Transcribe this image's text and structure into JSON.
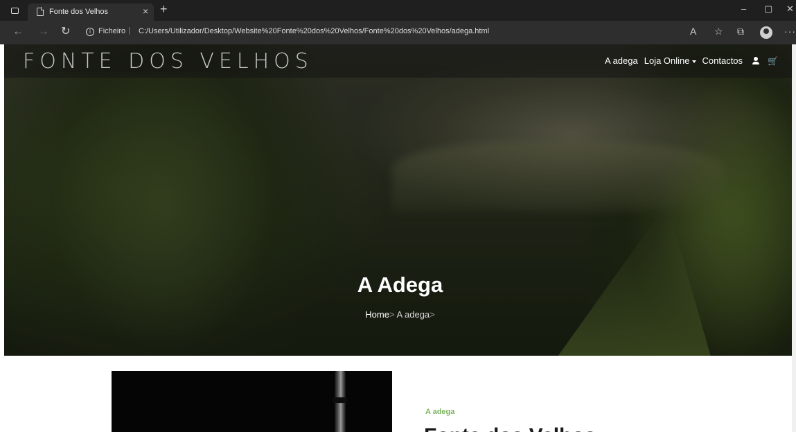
{
  "browser": {
    "tab_title": "Fonte dos Velhos",
    "tab_close": "×",
    "new_tab": "+",
    "window_controls": {
      "minimize": "–",
      "maximize": "▢",
      "close": "✕"
    },
    "back": "←",
    "forward": "→",
    "reload": "↻",
    "url_info": "i",
    "url_scheme": "Ficheiro",
    "url_separator": "|",
    "url": "C:/Users/Utilizador/Desktop/Website%20Fonte%20dos%20Velhos/Fonte%20dos%20Velhos/adega.html",
    "toolbar_icons": [
      "read-aloud-icon",
      "favorites-icon",
      "collections-icon",
      "profile-icon",
      "more-icon"
    ],
    "more": "···"
  },
  "site": {
    "logo": "FONTE DOS VELHOS",
    "nav": {
      "adega": "A adega",
      "loja": "Loja Online",
      "contactos": "Contactos",
      "cart": "🛒"
    },
    "hero": {
      "title": "A Adega",
      "breadcrumb_home": "Home",
      "breadcrumb_sep": ">",
      "breadcrumb_current": "A adega"
    },
    "section": {
      "eyebrow": "A adega",
      "heading": "Fonte dos Velhos"
    }
  },
  "colors": {
    "accent": "#7ab55c",
    "browser_bg": "#1f1f1f",
    "address_bar": "#2e2e2e"
  }
}
